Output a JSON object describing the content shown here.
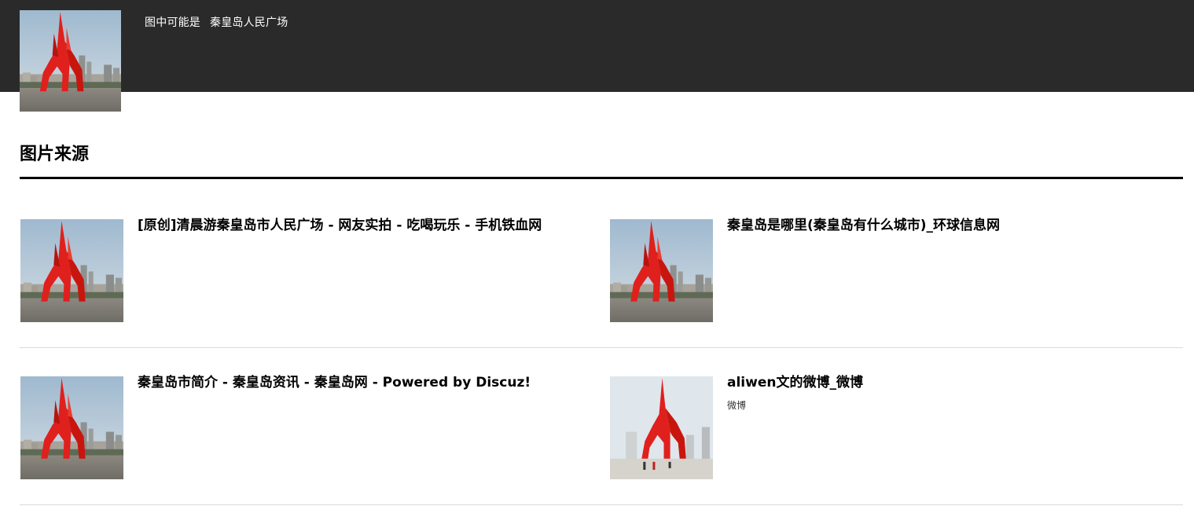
{
  "header": {
    "caption_prefix": "图中可能是",
    "caption_subject": "秦皇岛人民广场"
  },
  "section": {
    "title": "图片来源"
  },
  "results": [
    {
      "title": "[原创]清晨游秦皇岛市人民广场 - 网友实拍 - 吃喝玩乐 - 手机铁血网",
      "site": ""
    },
    {
      "title": "秦皇岛是哪里(秦皇岛有什么城市)_环球信息网",
      "site": ""
    },
    {
      "title": "秦皇岛市简介 - 秦皇岛资讯 - 秦皇岛网 - Powered by Discuz!",
      "site": ""
    },
    {
      "title": "aliwen文的微博_微博",
      "site": "微博"
    }
  ],
  "colors": {
    "topbar": "#2a2a2a",
    "sculpture": "#e0201c",
    "sky": "#b9c9d6"
  }
}
